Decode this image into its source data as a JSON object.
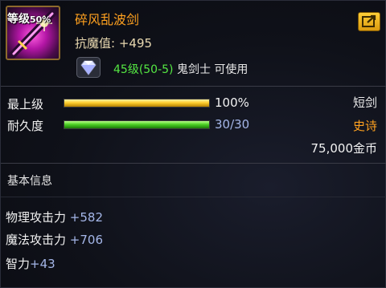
{
  "item": {
    "grade_label": "等级",
    "grade_percent": "50%",
    "name": "碎风乱波剑",
    "main_stat_label": "抗魔值:",
    "main_stat_value": "+495",
    "requirement_level": "45级(50-5)",
    "requirement_class": "鬼剑士 可使用",
    "icon": "sword-icon",
    "gem_icon": "gem-icon",
    "share_icon": "share-icon"
  },
  "bars": [
    {
      "label": "最上级",
      "value_text": "100%",
      "fill_ratio": 1.0,
      "color": "#ffcf30",
      "right_text": "短剑",
      "right_color": "#e8e8e8"
    },
    {
      "label": "耐久度",
      "value_text": "30/30",
      "fill_ratio": 1.0,
      "color": "#4ed126",
      "right_text": "史诗",
      "right_color": "#ffa11f"
    }
  ],
  "price": "75,000金币",
  "basic_info_title": "基本信息",
  "attributes": [
    {
      "name": "物理攻击力",
      "value": "+582"
    },
    {
      "name": "魔法攻击力",
      "value": "+706"
    },
    {
      "name": "智力",
      "value": "+43"
    }
  ],
  "colors": {
    "title": "#ffa11f",
    "level_green": "#55e843",
    "attr_value": "#a4b6e8",
    "epic": "#ffa11f"
  }
}
